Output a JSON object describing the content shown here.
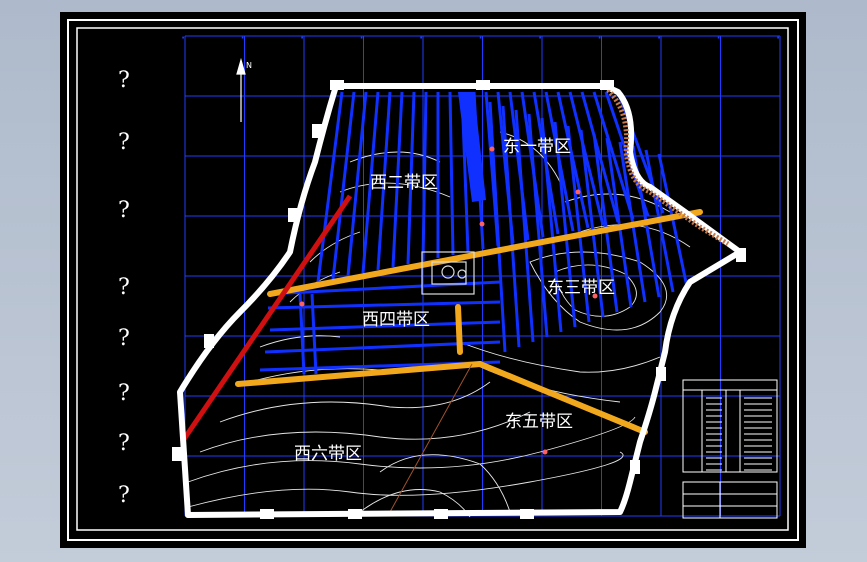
{
  "drawing": {
    "left_column_marks": [
      "?",
      "?",
      "?",
      "?",
      "?",
      "?",
      "?",
      "?"
    ],
    "north_arrow_label": "N",
    "zones": [
      {
        "id": "east-one",
        "label": "东一带区"
      },
      {
        "id": "west-two",
        "label": "西二带区"
      },
      {
        "id": "east-three",
        "label": "东三带区"
      },
      {
        "id": "west-four",
        "label": "西四带区"
      },
      {
        "id": "east-five",
        "label": "东五带区"
      },
      {
        "id": "west-six",
        "label": "西六带区"
      }
    ],
    "legend_header": "",
    "title_block_text": ""
  },
  "colors": {
    "background": "#000000",
    "frame": "#ffffff",
    "grid": "#1f3cff",
    "roadway_blue": "#1030ff",
    "main_roadway": "#f2a81c",
    "fault_line": "#d01010",
    "boundary": "#ffffff",
    "contour": "#e8e8e8"
  }
}
